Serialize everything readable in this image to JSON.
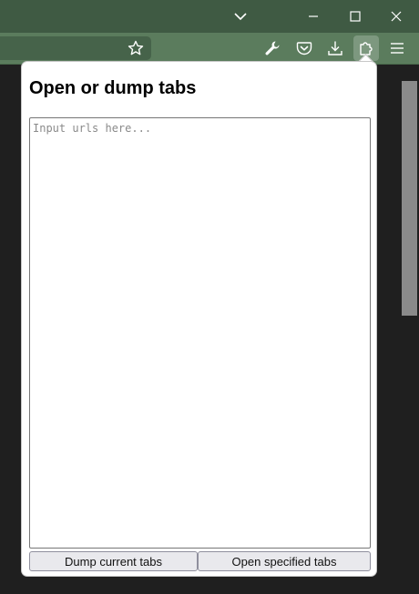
{
  "titlebar": {
    "icons": [
      "chevron-down-icon",
      "minimize-icon",
      "maximize-icon",
      "close-icon"
    ]
  },
  "toolbar": {
    "icons": [
      "bookmark-star-icon",
      "wrench-icon",
      "pocket-icon",
      "download-icon",
      "extensions-icon",
      "menu-icon"
    ],
    "active_icon": "extensions-icon"
  },
  "popup": {
    "title": "Open or dump tabs",
    "urls_placeholder": "Input urls here...",
    "urls_value": "",
    "dump_button_label": "Dump current tabs",
    "open_button_label": "Open specified tabs"
  },
  "colors": {
    "titlebar": "#3f5a43",
    "toolbar": "#5b7c5d",
    "page_background": "#1f1f1f",
    "popup_background": "#ffffff"
  }
}
